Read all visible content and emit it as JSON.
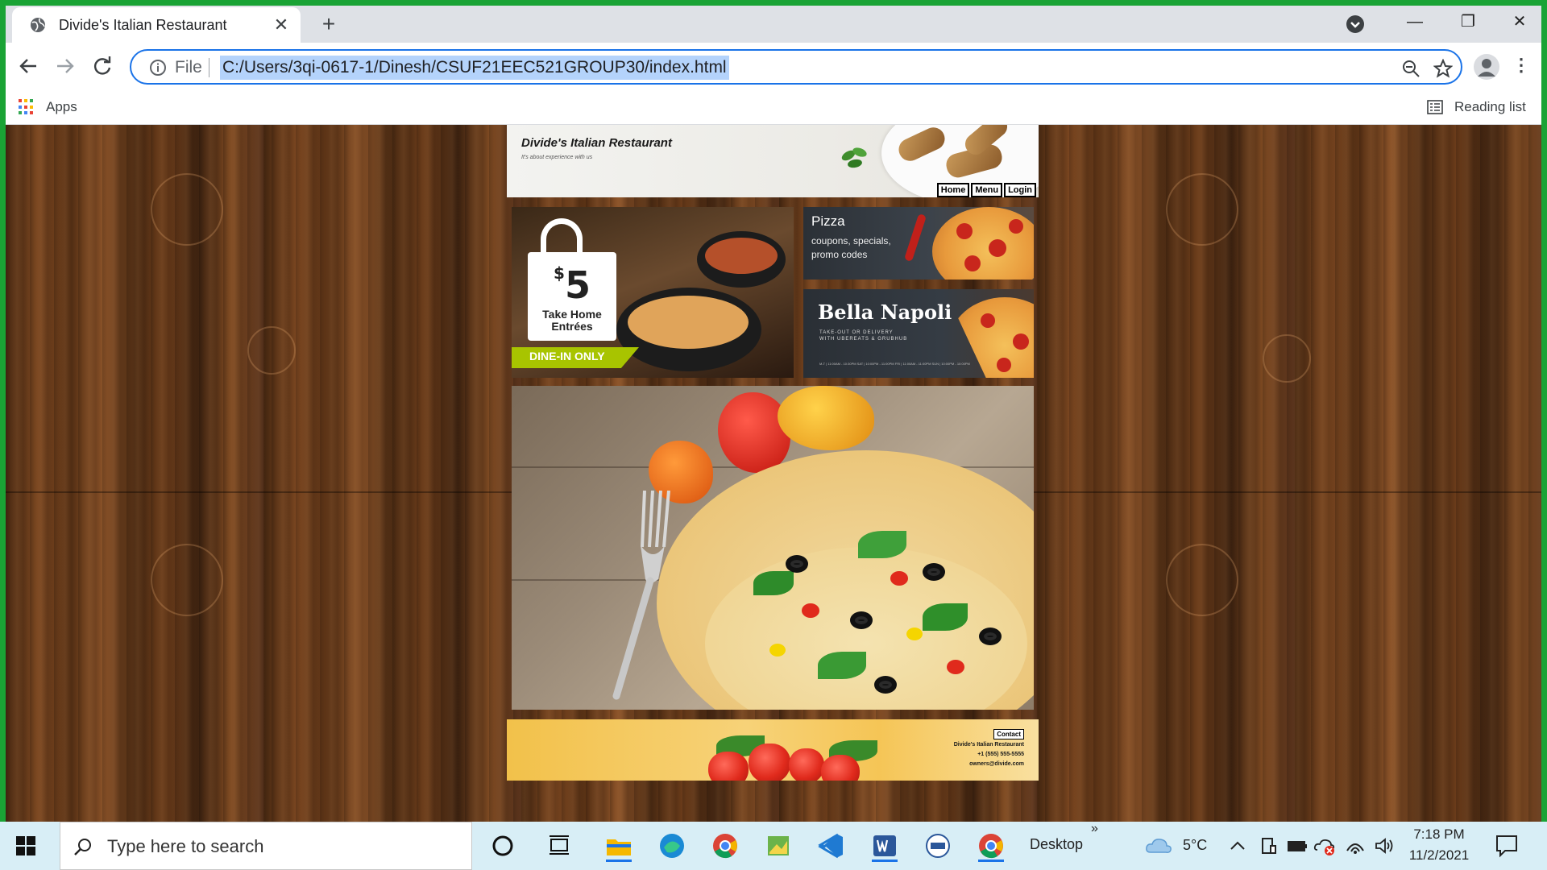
{
  "browser": {
    "tab_title": "Divide's Italian Restaurant",
    "tab_close": "✕",
    "new_tab": "+",
    "omnibox": {
      "scheme_label": "File",
      "url": "C:/Users/3qi-0617-1/Dinesh/CSUF21EEC521GROUP30/index.html"
    },
    "bookmarks": {
      "apps_label": "Apps",
      "reading_list_label": "Reading list"
    },
    "window_controls": {
      "minimize": "—",
      "restore": "❐",
      "close": "✕"
    },
    "menu_glyph": "⋮"
  },
  "site": {
    "title": "Divide's Italian Restaurant",
    "tagline": "It's about experience with us",
    "nav": [
      "Home",
      "Menu",
      "Login"
    ],
    "promo_take_home": {
      "price_symbol": "$",
      "price": "5",
      "label_line1": "Take Home",
      "label_line2": "Entrées",
      "banner": "DINE-IN ONLY"
    },
    "promo_pizza": {
      "title": "Pizza",
      "subtitle": "coupons, specials, promo codes"
    },
    "promo_bella": {
      "title": "Bella Napoli",
      "subtitle": "TAKE-OUT OR DELIVERY WITH UBEREATS & GRUBHUB",
      "hours": "M-T | 11:00AM - 10:30PM    SAT | 10:00PM - 11:00PM    FRI | 11:00AM - 11:00PM    SUN | 10:00PM - 10:00PM"
    },
    "footer": {
      "contact_button": "Contact",
      "name": "Divide's Italian Restaurant",
      "phone": "+1 (555) 555-5555",
      "email": "owners@divide.com"
    }
  },
  "taskbar": {
    "search_placeholder": "Type here to search",
    "desktop_label": "Desktop",
    "chevron": "»",
    "weather": "5°C",
    "time": "7:18 PM",
    "date": "11/2/2021",
    "pinned": [
      "cortana-icon",
      "task-view-icon",
      "file-explorer-icon",
      "edge-icon",
      "chrome-icon",
      "image-app-icon",
      "vscode-icon",
      "word-icon",
      "cop-app-icon",
      "chrome-active-icon"
    ]
  }
}
